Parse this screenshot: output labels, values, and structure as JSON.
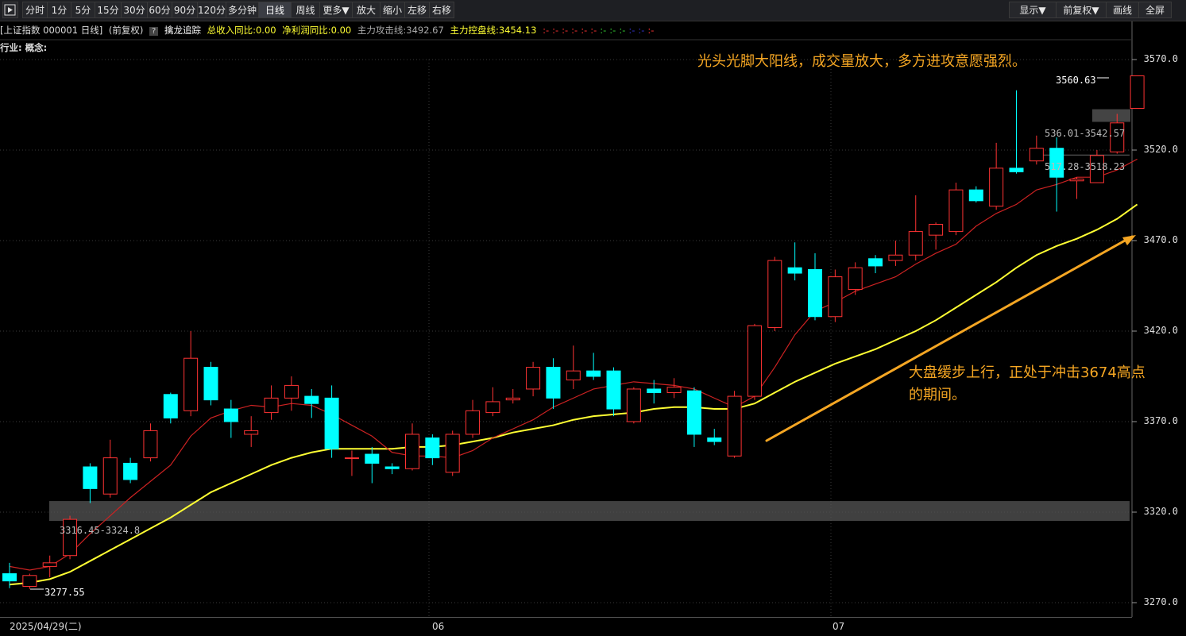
{
  "toolbar": {
    "left": [
      "分时",
      "1分",
      "5分",
      "15分",
      "30分",
      "60分",
      "90分",
      "120分",
      "多分钟",
      "日线",
      "周线",
      "更多▼",
      "放大",
      "缩小",
      "左移",
      "右移"
    ],
    "active": "日线",
    "right": [
      "显示▼",
      "前复权▼",
      "画线",
      "全屏"
    ]
  },
  "info": {
    "security": "[上证指数 000001 日线]",
    "fq": "(前复权)",
    "help": "?",
    "tool": "擒龙追踪",
    "income": "总收入同比:0.00",
    "profit": "净利润同比:0.00",
    "attack": "主力攻击线:3492.67",
    "control": "主力控盘线:3454.13",
    "dots": [
      {
        "text": ":-",
        "color": "#ff3333"
      },
      {
        "text": ":-",
        "color": "#ff3333"
      },
      {
        "text": ":-",
        "color": "#ff3333"
      },
      {
        "text": ":-",
        "color": "#ff3333"
      },
      {
        "text": ":-",
        "color": "#ff3333"
      },
      {
        "text": ":-",
        "color": "#ff3333"
      },
      {
        "text": ":-",
        "color": "#33cc33"
      },
      {
        "text": ":-",
        "color": "#33cc33"
      },
      {
        "text": ":-",
        "color": "#33cc33"
      },
      {
        "text": ":-",
        "color": "#3333cc"
      },
      {
        "text": ":-",
        "color": "#3333cc"
      },
      {
        "text": ":-",
        "color": "#ff3333"
      }
    ]
  },
  "industry": "行业: 概念:",
  "y_axis": [
    "3570.0",
    "3520.0",
    "3470.0",
    "3420.0",
    "3370.0",
    "3320.0",
    "3270.0"
  ],
  "x_axis": {
    "start": "2025/04/29(二)",
    "m1": "06",
    "m2": "07"
  },
  "labels": {
    "high": "3560.63",
    "low": "3277.55",
    "zone1": "3316.45-3324.8",
    "zone2": "536.01-3542.57",
    "zone3": "517.28-3518.23"
  },
  "annotations": {
    "top": "光头光脚大阳线，成交量放大，多方进攻意愿强烈。",
    "mid1": "大盘缓步上行，正处于冲击3674高点",
    "mid2": "的期间。"
  },
  "colors": {
    "up": "#ff3333",
    "down": "#00ffff",
    "ma5": "#cc2222",
    "ma20": "#ffff33",
    "arrow": "#f5a623"
  },
  "chart_data": {
    "type": "candlestick",
    "candles": [
      [
        3286,
        3282,
        3292,
        3278
      ],
      [
        3279,
        3285,
        3286,
        3277.55
      ],
      [
        3290,
        3292,
        3296,
        3284
      ],
      [
        3296,
        3316,
        3318,
        3294
      ],
      [
        3345,
        3333,
        3347,
        3325
      ],
      [
        3330,
        3350,
        3360,
        3328
      ],
      [
        3347,
        3338,
        3350,
        3336
      ],
      [
        3350,
        3365,
        3369,
        3348
      ],
      [
        3385,
        3372,
        3386,
        3369
      ],
      [
        3376,
        3405,
        3420,
        3373
      ],
      [
        3400,
        3382,
        3403,
        3379
      ],
      [
        3377,
        3370,
        3382,
        3361
      ],
      [
        3363,
        3365,
        3373,
        3356
      ],
      [
        3375,
        3383,
        3390,
        3371
      ],
      [
        3383,
        3390,
        3395,
        3376
      ],
      [
        3384,
        3380,
        3388,
        3372
      ],
      [
        3383,
        3355,
        3390,
        3350
      ],
      [
        3350,
        3350,
        3354,
        3340
      ],
      [
        3352,
        3347,
        3356,
        3336
      ],
      [
        3345,
        3344,
        3347,
        3341
      ],
      [
        3344,
        3363,
        3369,
        3343
      ],
      [
        3361,
        3350,
        3363,
        3346
      ],
      [
        3342,
        3363,
        3365,
        3340
      ],
      [
        3363,
        3376,
        3382,
        3361
      ],
      [
        3375,
        3381,
        3389,
        3373
      ],
      [
        3382,
        3383,
        3388,
        3380
      ],
      [
        3388,
        3400,
        3403,
        3384
      ],
      [
        3400,
        3383,
        3405,
        3377
      ],
      [
        3393,
        3398,
        3412,
        3388
      ],
      [
        3398,
        3395,
        3408,
        3393
      ],
      [
        3398,
        3377,
        3400,
        3373
      ],
      [
        3370,
        3388,
        3389,
        3369
      ],
      [
        3388,
        3386,
        3393,
        3380
      ],
      [
        3386,
        3389,
        3394,
        3383
      ],
      [
        3387,
        3363,
        3389,
        3356
      ],
      [
        3361,
        3359,
        3366,
        3357
      ],
      [
        3351,
        3384,
        3387,
        3350
      ],
      [
        3384,
        3423,
        3424,
        3382
      ],
      [
        3422,
        3459,
        3461,
        3420
      ],
      [
        3455,
        3452,
        3469,
        3448
      ],
      [
        3454,
        3428,
        3463,
        3426
      ],
      [
        3428,
        3450,
        3454,
        3425
      ],
      [
        3443,
        3455,
        3458,
        3440
      ],
      [
        3460,
        3456,
        3462,
        3452
      ],
      [
        3459,
        3462,
        3470,
        3456
      ],
      [
        3462,
        3475,
        3495,
        3459
      ],
      [
        3473,
        3479,
        3480,
        3465
      ],
      [
        3475,
        3498,
        3502,
        3473
      ],
      [
        3498,
        3492,
        3500,
        3491
      ],
      [
        3489,
        3510,
        3524,
        3487
      ],
      [
        3510,
        3508,
        3553,
        3507
      ],
      [
        3514,
        3521,
        3528,
        3512
      ],
      [
        3521,
        3505,
        3527,
        3486
      ],
      [
        3503,
        3504,
        3505,
        3493
      ],
      [
        3502,
        3517,
        3520,
        3502
      ],
      [
        3519,
        3535,
        3540,
        3518
      ],
      [
        3543,
        3561,
        3561,
        3543
      ]
    ],
    "ma5": [
      3290,
      3288,
      3290,
      3297,
      3308,
      3318,
      3328,
      3337,
      3346,
      3362,
      3372,
      3376,
      3379,
      3378,
      3380,
      3379,
      3374,
      3368,
      3362,
      3353,
      3351,
      3351,
      3350,
      3354,
      3361,
      3366,
      3371,
      3378,
      3383,
      3388,
      3390,
      3392,
      3391,
      3390,
      3388,
      3383,
      3378,
      3384,
      3400,
      3418,
      3431,
      3436,
      3442,
      3446,
      3450,
      3457,
      3463,
      3468,
      3478,
      3485,
      3490,
      3498,
      3501,
      3505,
      3505,
      3509,
      3515
    ],
    "ma20": [
      3280,
      3281,
      3283,
      3287,
      3293,
      3299,
      3305,
      3311,
      3317,
      3324,
      3331,
      3336,
      3341,
      3346,
      3350,
      3353,
      3355,
      3355,
      3355,
      3355,
      3356,
      3356,
      3357,
      3359,
      3361,
      3364,
      3366,
      3368,
      3371,
      3373,
      3374,
      3375,
      3377,
      3378,
      3378,
      3377,
      3377,
      3380,
      3386,
      3392,
      3397,
      3402,
      3406,
      3410,
      3415,
      3420,
      3426,
      3433,
      3440,
      3447,
      3455,
      3462,
      3467,
      3471,
      3476,
      3482,
      3490
    ],
    "ylim": [
      3265,
      3580
    ],
    "ticks": [
      3570,
      3520,
      3470,
      3420,
      3370,
      3320,
      3270
    ],
    "zones": [
      [
        3316.45,
        3324.8
      ],
      [
        3536.01,
        3542.57
      ],
      [
        3517.28,
        3518.23
      ]
    ]
  }
}
